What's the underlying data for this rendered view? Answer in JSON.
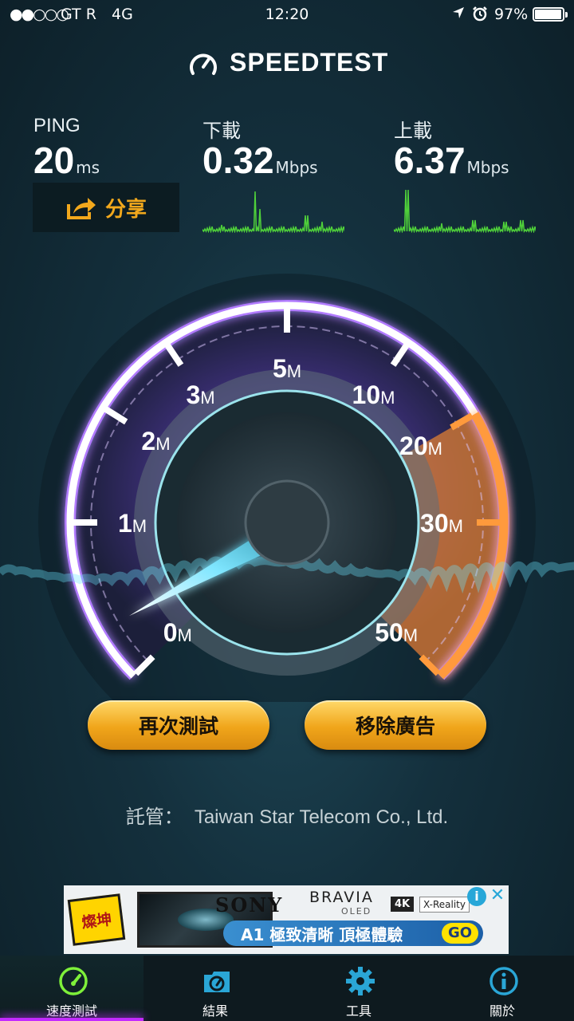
{
  "status_bar": {
    "signal": "●●○○○",
    "carrier": "GT R",
    "network": "4G",
    "time": "12:20",
    "battery_percent": "97%",
    "battery_level": 0.97,
    "icons": [
      "location-arrow-icon",
      "alarm-icon",
      "battery-icon"
    ]
  },
  "brand": {
    "name": "SPEEDTEST",
    "trademark": "™"
  },
  "metrics": {
    "ping": {
      "label": "PING",
      "value": "20",
      "unit": "ms"
    },
    "download": {
      "label": "下載",
      "value": "0.32",
      "unit": "Mbps"
    },
    "upload": {
      "label": "上載",
      "value": "6.37",
      "unit": "Mbps"
    }
  },
  "share": {
    "label": "分享",
    "icon": "share-icon"
  },
  "gauge": {
    "scale": [
      {
        "num": "0",
        "unit": "M"
      },
      {
        "num": "1",
        "unit": "M"
      },
      {
        "num": "2",
        "unit": "M"
      },
      {
        "num": "3",
        "unit": "M"
      },
      {
        "num": "5",
        "unit": "M"
      },
      {
        "num": "10",
        "unit": "M"
      },
      {
        "num": "20",
        "unit": "M"
      },
      {
        "num": "30",
        "unit": "M"
      },
      {
        "num": "50",
        "unit": "M"
      }
    ],
    "current_mbps": 0.32,
    "colors": {
      "track": "#b27bff",
      "active_arc": "#ff9a3c",
      "needle": "#7fe6ff"
    }
  },
  "buttons": {
    "retest": "再次測試",
    "remove_ads": "移除廣告"
  },
  "host": {
    "label": "託管：",
    "name": "Taiwan Star Telecom Co., Ltd."
  },
  "ad": {
    "logo_text": "燦坤",
    "brand": "SONY",
    "product": "BRAVIA",
    "sub": "OLED",
    "badge_4k": "4K",
    "badge_xr": "X-Reality",
    "slogan": "A1 極致清晰  頂極體驗",
    "cta": "GO",
    "info": "i",
    "close": "✕"
  },
  "tabs": [
    {
      "label": "速度測試",
      "icon": "speedometer-icon",
      "active": true
    },
    {
      "label": "結果",
      "icon": "results-icon",
      "active": false
    },
    {
      "label": "工具",
      "icon": "gear-icon",
      "active": false
    },
    {
      "label": "關於",
      "icon": "info-icon",
      "active": false
    }
  ]
}
